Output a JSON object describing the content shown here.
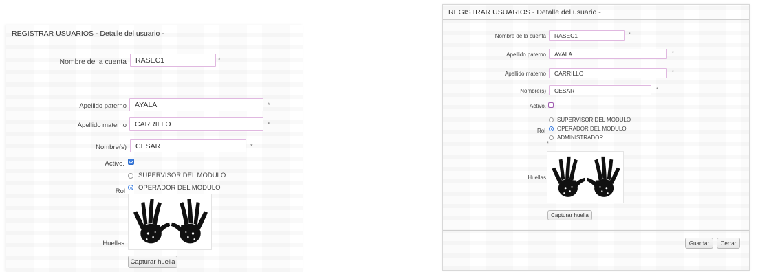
{
  "form": {
    "title": "REGISTRAR USUARIOS - Detalle del usuario -",
    "labels": {
      "account": "Nombre de la cuenta",
      "paternal": "Apellido paterno",
      "maternal": "Apellido materno",
      "names": "Nombre(s)",
      "active": "Activo",
      "role": "Rol",
      "fingerprints": "Huellas"
    },
    "required_mark": "*",
    "role_options": [
      "SUPERVISOR DEL MODULO",
      "OPERADOR DEL MODULO",
      "ADMINISTRADOR"
    ],
    "capture_button": "Capturar huella",
    "save_button": "Guardar",
    "close_button": "Cerrar"
  },
  "left_view": {
    "account": "RASEC1",
    "paternal": "AYALA",
    "maternal": "CARRILLO",
    "names": "CESAR",
    "active_label": "Activo.",
    "active": true,
    "selected_role": "OPERADOR DEL MODULO"
  },
  "right_view": {
    "account": "RASEC1",
    "paternal": "AYALA",
    "maternal": "CARRILLO",
    "names": "CESAR",
    "active_label": "Activo.",
    "active": false,
    "selected_role": "OPERADOR DEL MODULO"
  },
  "icons": {
    "hands": "handprints-icon"
  },
  "colors": {
    "input_border": "#e0b8e0",
    "checkbox_checked": "#3b7de0",
    "checkbox_unchecked_border": "#a05cb0",
    "radio_selected": "#3b7de0"
  }
}
